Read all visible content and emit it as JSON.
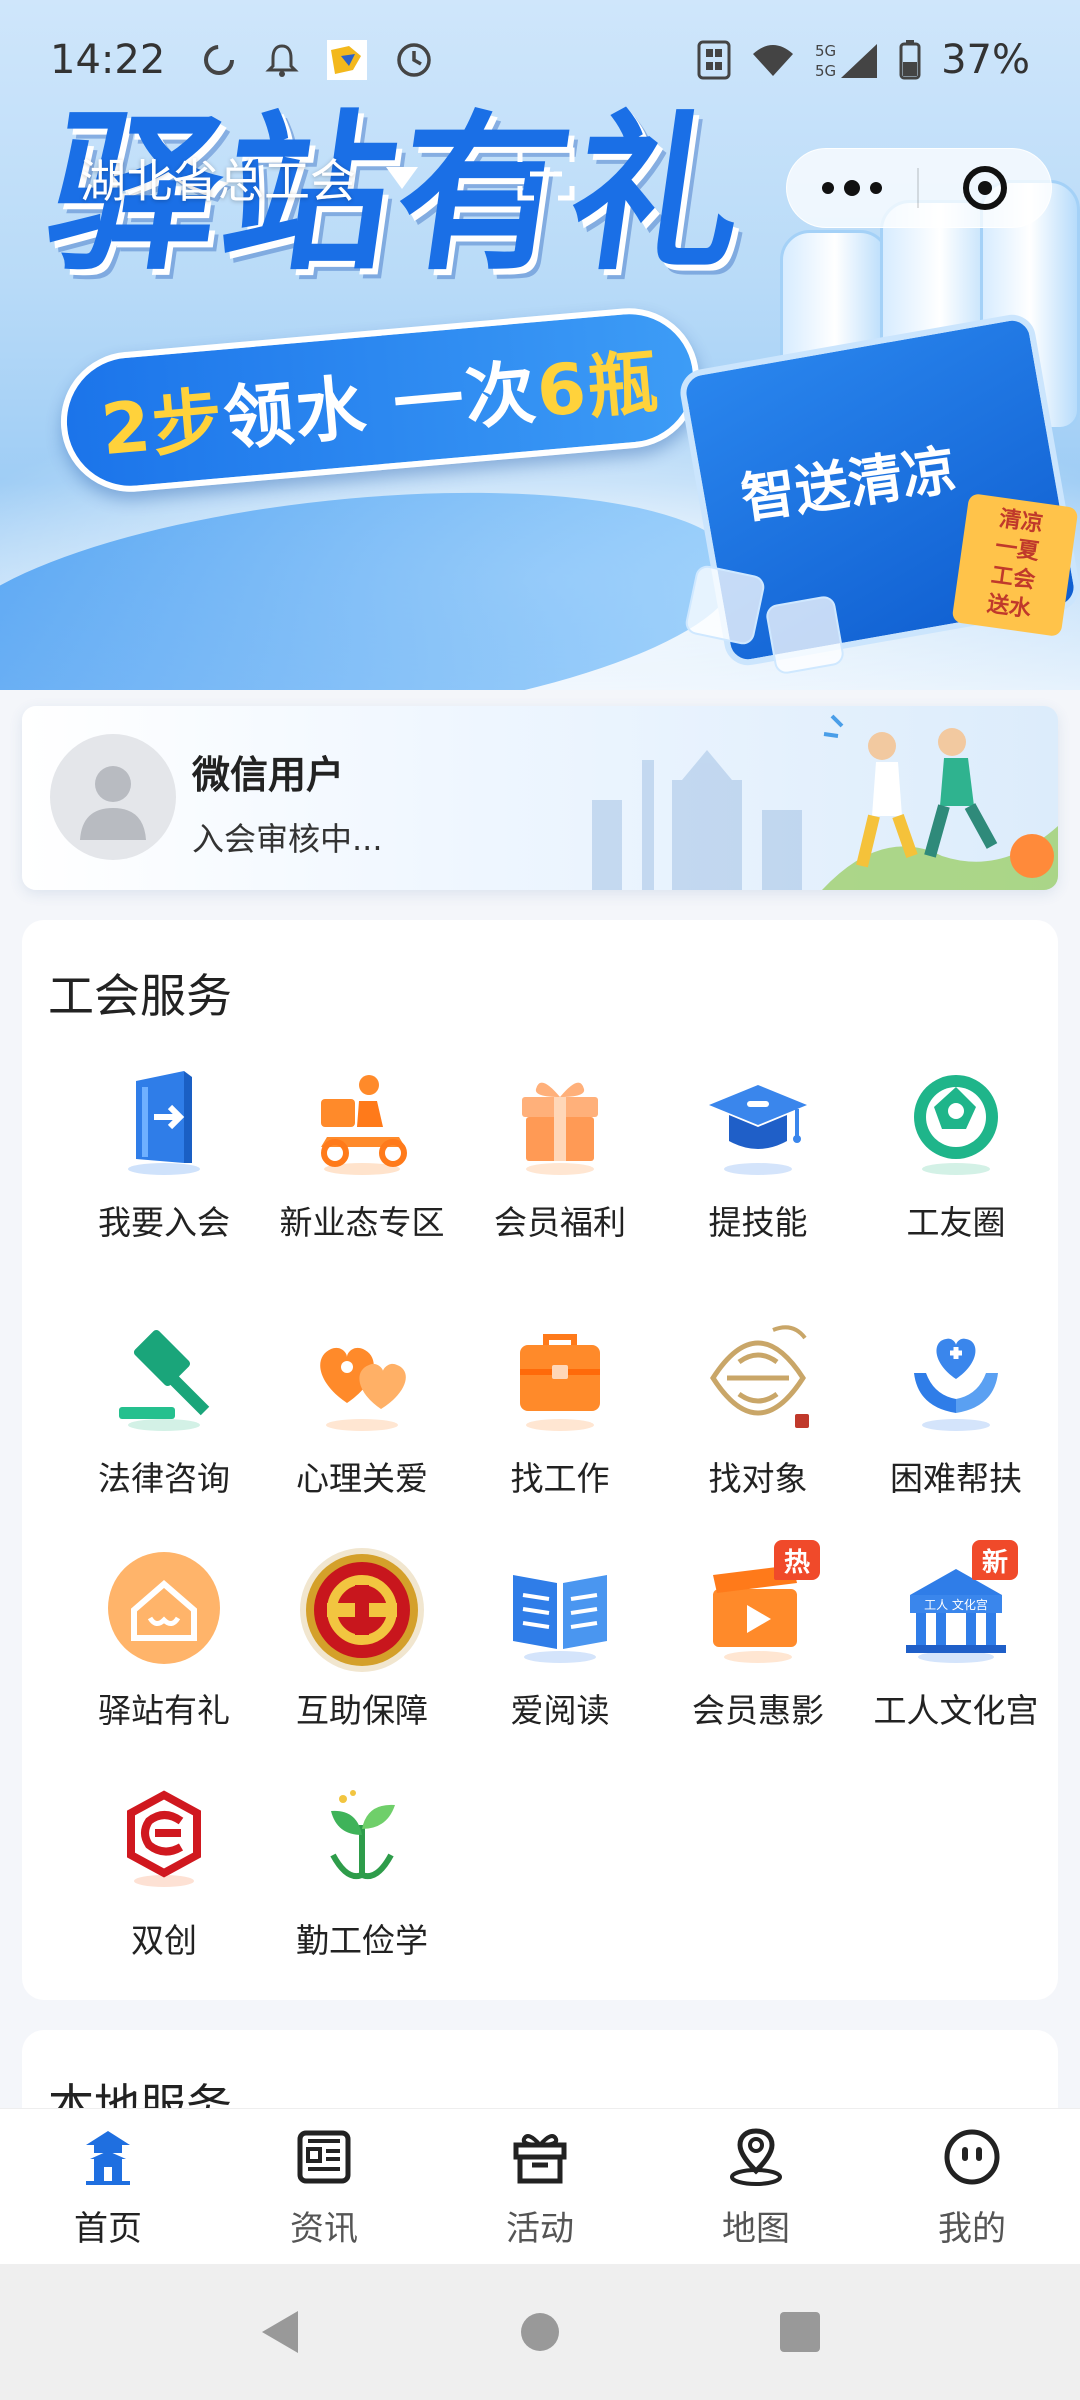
{
  "status_bar": {
    "time": "14:22",
    "battery": "37%",
    "network": "5G"
  },
  "header": {
    "region": "湖北省总工会"
  },
  "banner": {
    "title": "驿站有礼",
    "pill_a": "2步",
    "pill_b": " 领水 一次 ",
    "pill_c": "6瓶",
    "cooler_text": "智送清凉",
    "tag_text": "清凉一夏 工会送水"
  },
  "user": {
    "name": "微信用户",
    "status": "入会审核中..."
  },
  "services": {
    "title": "工会服务",
    "items": [
      {
        "label": "我要入会",
        "icon": "door-icon"
      },
      {
        "label": "新业态专区",
        "icon": "delivery-icon"
      },
      {
        "label": "会员福利",
        "icon": "gift-icon"
      },
      {
        "label": "提技能",
        "icon": "graduation-cap-icon"
      },
      {
        "label": "工友圈",
        "icon": "aperture-icon"
      },
      {
        "label": "法律咨询",
        "icon": "gavel-icon"
      },
      {
        "label": "心理关爱",
        "icon": "hearts-icon"
      },
      {
        "label": "找工作",
        "icon": "briefcase-icon"
      },
      {
        "label": "找对象",
        "icon": "love-knot-icon"
      },
      {
        "label": "困难帮扶",
        "icon": "helping-hands-icon"
      },
      {
        "label": "驿站有礼",
        "icon": "station-icon"
      },
      {
        "label": "互助保障",
        "icon": "union-emblem-icon"
      },
      {
        "label": "爱阅读",
        "icon": "book-icon"
      },
      {
        "label": "会员惠影",
        "icon": "movie-icon",
        "badge": "热"
      },
      {
        "label": "工人文化宫",
        "icon": "culture-palace-icon",
        "badge": "新",
        "sign": "工人 文化宫"
      },
      {
        "label": "双创",
        "icon": "innovation-icon"
      },
      {
        "label": "勤工俭学",
        "icon": "sprout-icon"
      }
    ]
  },
  "local_services": {
    "title": "本地服务"
  },
  "tabbar": {
    "items": [
      {
        "label": "首页",
        "icon": "home-tower-icon",
        "active": true
      },
      {
        "label": "资讯",
        "icon": "news-icon"
      },
      {
        "label": "活动",
        "icon": "gift-box-icon"
      },
      {
        "label": "地图",
        "icon": "map-pin-icon"
      },
      {
        "label": "我的",
        "icon": "profile-face-icon"
      }
    ]
  },
  "colors": {
    "brand_blue": "#1a6fe6",
    "badge_red": "#f04a2a",
    "orange": "#ff8a2a"
  }
}
